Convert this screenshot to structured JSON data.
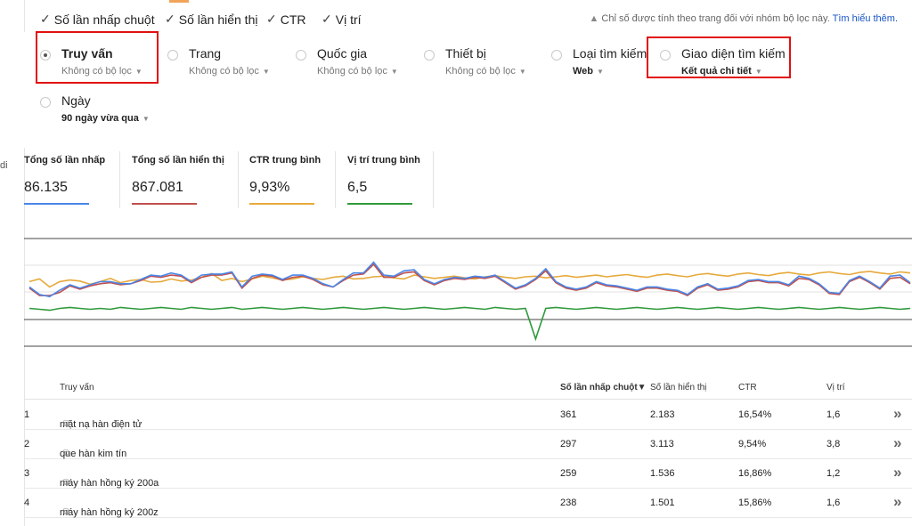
{
  "topbar": {
    "metrics": [
      {
        "label": "Số lần nhấp chuột",
        "checked": true
      },
      {
        "label": "Số lần hiển thị",
        "checked": true
      },
      {
        "label": "CTR",
        "checked": true
      },
      {
        "label": "Vị trí",
        "checked": true
      }
    ],
    "note": "Chỉ số được tính theo trang đối với nhóm bộ lọc này.",
    "learn_more": "Tìm hiểu thêm."
  },
  "left_gutter_text": "di",
  "filters": {
    "truy_van": {
      "label": "Truy vấn",
      "sub": "Không có bộ lọc"
    },
    "trang": {
      "label": "Trang",
      "sub": "Không có bộ lọc"
    },
    "quoc_gia": {
      "label": "Quốc gia",
      "sub": "Không có bộ lọc"
    },
    "thiet_bi": {
      "label": "Thiết bị",
      "sub": "Không có bộ lọc"
    },
    "loai_tim_kiem": {
      "label": "Loại tìm kiếm",
      "sub": "Web"
    },
    "giao_dien": {
      "label": "Giao diện tìm kiếm",
      "sub": "Kết quả chi tiết"
    },
    "ngay": {
      "label": "Ngày",
      "sub": "90 ngày vừa qua"
    }
  },
  "summary": [
    {
      "title": "Tổng số lần nhấp",
      "value": "86.135",
      "color": "#4a86e8"
    },
    {
      "title": "Tổng số lần hiển thị",
      "value": "867.081",
      "color": "#c0504d"
    },
    {
      "title": "CTR trung bình",
      "value": "9,93%",
      "color": "#e6a93b"
    },
    {
      "title": "Vị trí trung bình",
      "value": "6,5",
      "color": "#2f9a3b"
    }
  ],
  "chart_data": {
    "type": "line",
    "title": "",
    "grid": true,
    "series": [
      {
        "name": "Tổng số lần nhấp",
        "color": "#4a86e8",
        "values": [
          55,
          48,
          46,
          52,
          57,
          54,
          57,
          60,
          60,
          58,
          58,
          62,
          66,
          65,
          68,
          66,
          60,
          66,
          67,
          67,
          69,
          55,
          65,
          67,
          66,
          62,
          66,
          66,
          63,
          58,
          55,
          62,
          68,
          68,
          78,
          66,
          65,
          70,
          71,
          62,
          58,
          62,
          64,
          63,
          65,
          64,
          66,
          60,
          54,
          57,
          63,
          72,
          60,
          55,
          53,
          55,
          60,
          57,
          56,
          54,
          52,
          55,
          55,
          53,
          52,
          48,
          55,
          58,
          53,
          54,
          56,
          61,
          62,
          60,
          60,
          57,
          65,
          63,
          58,
          50,
          49,
          61,
          65,
          60,
          54,
          65,
          66,
          59
        ]
      },
      {
        "name": "Tổng số lần hiển thị",
        "color": "#c0504d",
        "values": [
          54,
          47,
          47,
          50,
          56,
          53,
          56,
          58,
          59,
          57,
          58,
          61,
          65,
          64,
          66,
          65,
          59,
          64,
          66,
          66,
          68,
          54,
          63,
          66,
          65,
          61,
          64,
          65,
          62,
          57,
          55,
          61,
          66,
          67,
          76,
          64,
          64,
          68,
          69,
          61,
          57,
          61,
          63,
          62,
          64,
          63,
          65,
          59,
          53,
          56,
          62,
          70,
          59,
          54,
          52,
          54,
          59,
          56,
          55,
          53,
          51,
          54,
          54,
          52,
          51,
          47,
          54,
          57,
          52,
          53,
          55,
          60,
          61,
          59,
          59,
          56,
          63,
          62,
          57,
          49,
          48,
          60,
          64,
          59,
          53,
          63,
          64,
          58
        ]
      },
      {
        "name": "CTR trung bình",
        "color": "#e6a93b",
        "values": [
          12,
          12.5,
          11,
          12,
          12.3,
          12.1,
          11.5,
          12,
          12.6,
          11.8,
          12.2,
          12.4,
          11.9,
          12,
          12.5,
          12.1,
          12.3,
          12.8,
          13.5,
          12.2,
          12.6,
          12,
          12.5,
          13,
          12.7,
          12.3,
          12.5,
          12.9,
          12.6,
          12.4,
          12.8,
          13,
          12.5,
          12.6,
          12.9,
          13,
          12.7,
          12.5,
          13.2,
          12.9,
          12.6,
          12.8,
          13,
          12.7,
          12.5,
          12.9,
          13.1,
          12.8,
          12.6,
          12.9,
          13,
          12.7,
          12.9,
          13.1,
          12.8,
          13,
          13.2,
          12.9,
          13.1,
          13.3,
          13,
          12.8,
          13.2,
          13.4,
          13.1,
          12.9,
          13.3,
          13.5,
          13.2,
          13,
          13.4,
          13.6,
          13.3,
          13.1,
          13.5,
          13.7,
          13.4,
          13.2,
          13.6,
          13.8,
          13.5,
          13.3,
          13.7,
          13.9,
          13.6,
          13.4,
          13.8,
          13.6
        ]
      },
      {
        "name": "Vị trí trung bình",
        "color": "#2f9a3b",
        "values": [
          6.2,
          6.3,
          6.4,
          6.2,
          6.1,
          6.2,
          6.3,
          6.2,
          6.3,
          6.1,
          6.2,
          6.3,
          6.2,
          6.1,
          6.2,
          6.3,
          6.1,
          6.2,
          6.3,
          6.2,
          6.1,
          6.3,
          6.2,
          6.1,
          6.2,
          6.3,
          6.2,
          6.1,
          6.2,
          6.3,
          6.2,
          6.1,
          6.2,
          6.3,
          6.2,
          6.1,
          6.2,
          6.3,
          6.2,
          6.1,
          6.2,
          6.3,
          6.2,
          6.1,
          6.2,
          6.3,
          6.1,
          6.2,
          6.3,
          6.2,
          9.5,
          6.2,
          6.1,
          6.2,
          6.3,
          6.2,
          6.1,
          6.2,
          6.3,
          6.2,
          6.1,
          6.2,
          6.3,
          6.2,
          6.1,
          6.2,
          6.3,
          6.2,
          6.1,
          6.2,
          6.3,
          6.2,
          6.1,
          6.2,
          6.3,
          6.2,
          6.1,
          6.2,
          6.3,
          6.2,
          6.1,
          6.2,
          6.3,
          6.2,
          6.1,
          6.2,
          6.3,
          6.2
        ]
      }
    ]
  },
  "table": {
    "headers": {
      "query": "Truy vấn",
      "clicks": "Số lần nhấp chuột▼",
      "impressions": "Số lần hiển thị",
      "ctr": "CTR",
      "position": "Vị trí"
    },
    "rows": [
      {
        "rank": "1",
        "query": "mặt nạ hàn điện tử",
        "clicks": "361",
        "impressions": "2.183",
        "ctr": "16,54%",
        "position": "1,6"
      },
      {
        "rank": "2",
        "query": "que hàn kim tín",
        "clicks": "297",
        "impressions": "3.113",
        "ctr": "9,54%",
        "position": "3,8"
      },
      {
        "rank": "3",
        "query": "máy hàn hồng ký 200a",
        "clicks": "259",
        "impressions": "1.536",
        "ctr": "16,86%",
        "position": "1,2"
      },
      {
        "rank": "4",
        "query": "máy hàn hồng ký 200z",
        "clicks": "238",
        "impressions": "1.501",
        "ctr": "15,86%",
        "position": "1,6"
      }
    ]
  }
}
